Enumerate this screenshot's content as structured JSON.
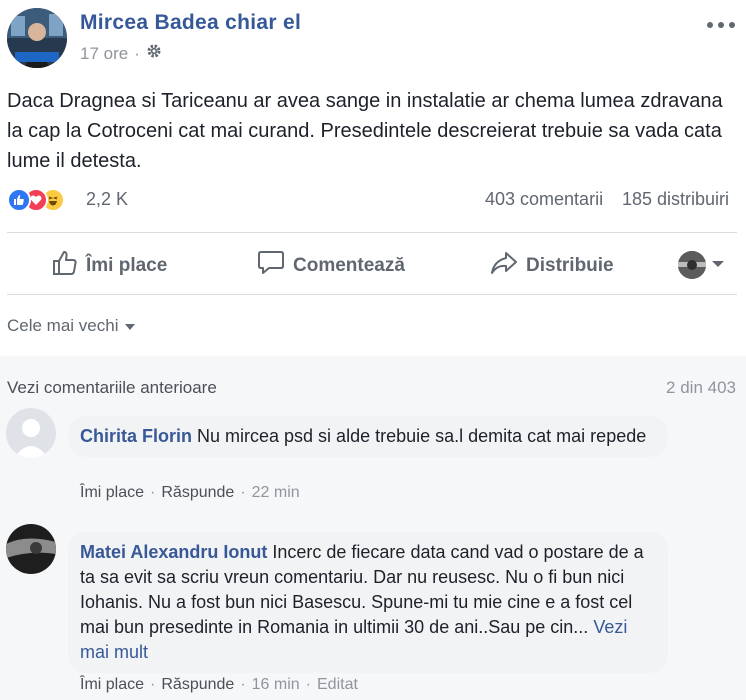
{
  "post": {
    "author": "Mircea Badea chiar el",
    "time": "17 ore",
    "separator": "·",
    "text": "Daca Dragnea si Tariceanu ar avea sange in instalatie ar chema lumea zdravana la cap la Cotroceni cat mai curand. Presedintele descreierat trebuie sa vada cata lume il detesta.",
    "reaction_count": "2,2 K",
    "comments_count": "403 comentarii",
    "shares_count": "185 distribuiri"
  },
  "actions": {
    "like": "Îmi place",
    "comment": "Comentează",
    "share": "Distribuie"
  },
  "sort": {
    "label": "Cele mai vechi"
  },
  "comments_section": {
    "view_previous": "Vezi comentariile anterioare",
    "page_count": "2 din 403"
  },
  "comments": [
    {
      "author": "Chirita Florin",
      "text": "Nu mircea psd si alde trebuie sa.l demita cat mai repede",
      "like": "Îmi place",
      "reply": "Răspunde",
      "dot": "·",
      "time": "22 min"
    },
    {
      "author": "Matei Alexandru Ionut",
      "text": "Incerc de fiecare data cand vad o postare de a ta sa evit sa scriu vreun comentariu. Dar nu reusesc. Nu o fi bun nici Iohanis. Nu a fost bun nici Basescu. Spune-mi tu mie cine e a fost cel mai bun presedinte in Romania in ultimii 30 de ani..Sau pe cin...",
      "see_more": "Vezi mai mult",
      "like": "Îmi place",
      "reply": "Răspunde",
      "dot": "·",
      "time": "16 min",
      "edited": "Editat"
    }
  ],
  "icons": {
    "settings": "gear-icon",
    "more": "more-dots-icon",
    "like": "thumbs-up-icon",
    "comment": "speech-bubble-icon",
    "share": "share-arrow-icon"
  },
  "colors": {
    "link_blue": "#365899",
    "muted_gray": "#606770",
    "like_blue": "#2f76f4",
    "love_red": "#f33e58",
    "haha_yellow": "#fcc942"
  }
}
